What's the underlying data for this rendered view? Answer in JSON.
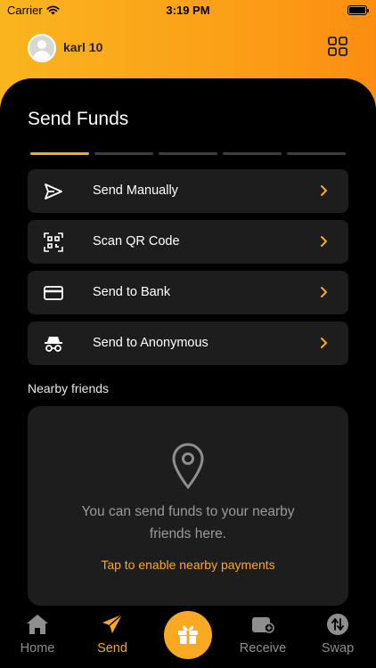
{
  "status_bar": {
    "carrier": "Carrier",
    "time": "3:19 PM"
  },
  "header": {
    "username": "karl 10",
    "menu_icon": "grid-icon",
    "avatar_icon": "user-avatar-icon"
  },
  "page": {
    "title": "Send Funds"
  },
  "progress": {
    "total_steps": 5,
    "active_step": 1
  },
  "send_options": [
    {
      "label": "Send Manually",
      "icon": "send-arrow-icon"
    },
    {
      "label": "Scan QR Code",
      "icon": "qr-scan-icon"
    },
    {
      "label": "Send to Bank",
      "icon": "bank-card-icon"
    },
    {
      "label": "Send to Anonymous",
      "icon": "incognito-icon"
    }
  ],
  "nearby": {
    "heading": "Nearby friends",
    "message": "You can send funds to your nearby friends here.",
    "cta": "Tap to enable nearby payments"
  },
  "tabbar": {
    "home": "Home",
    "send": "Send",
    "receive": "Receive",
    "swap": "Swap"
  },
  "colors": {
    "accent": "#f8a921",
    "panel": "#000000",
    "card": "#1d1d1d",
    "muted": "#8e8e8e"
  }
}
